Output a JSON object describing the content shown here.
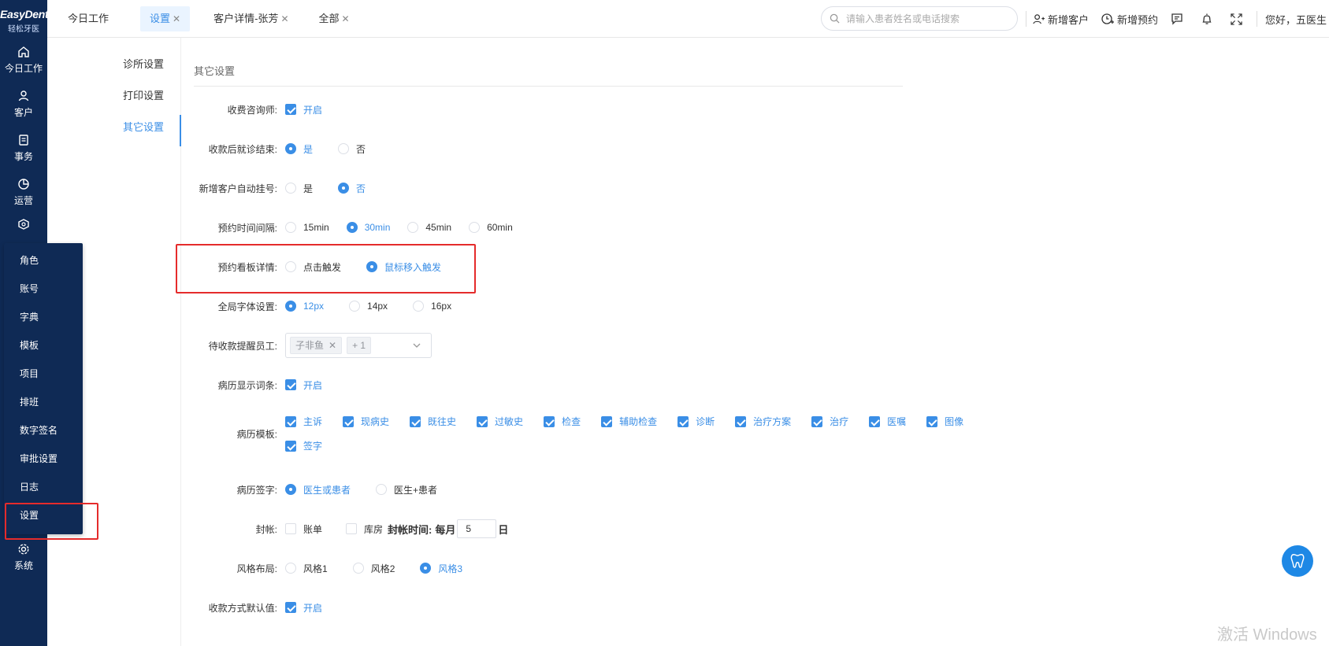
{
  "app": {
    "brand": "EasyDent",
    "brand_sub": "轻松牙医"
  },
  "sidenav": {
    "items": [
      {
        "label": "今日工作",
        "icon": "home-icon"
      },
      {
        "label": "客户",
        "icon": "user-icon"
      },
      {
        "label": "事务",
        "icon": "document-icon"
      },
      {
        "label": "运营",
        "icon": "pie-chart-icon"
      }
    ],
    "system_label": "系统"
  },
  "flyout": {
    "items": [
      "角色",
      "账号",
      "字典",
      "模板",
      "项目",
      "排班",
      "数字签名",
      "审批设置",
      "日志",
      "设置"
    ]
  },
  "tabs": [
    {
      "label": "今日工作",
      "closable": false
    },
    {
      "label": "设置",
      "closable": true,
      "active": true
    },
    {
      "label": "客户详情-张芳",
      "closable": true
    },
    {
      "label": "全部",
      "closable": true
    }
  ],
  "search": {
    "placeholder": "请输入患者姓名或电话搜索"
  },
  "actions": {
    "new_customer": "新增客户",
    "new_appointment": "新增预约",
    "greeting": "您好，五医生"
  },
  "settings_menu": [
    "诊所设置",
    "打印设置",
    "其它设置"
  ],
  "section_title": "其它设置",
  "form": {
    "fee_consultant": {
      "label": "收费咨询师:",
      "opt": "开启"
    },
    "end_after_pay": {
      "label": "收款后就诊结束:",
      "opts": [
        "是",
        "否"
      ]
    },
    "auto_register": {
      "label": "新增客户自动挂号:",
      "opts": [
        "是",
        "否"
      ]
    },
    "appt_interval": {
      "label": "预约时间间隔:",
      "opts": [
        "15min",
        "30min",
        "45min",
        "60min"
      ]
    },
    "board_detail": {
      "label": "预约看板详情:",
      "opts": [
        "点击触发",
        "鼠标移入触发"
      ]
    },
    "font_size": {
      "label": "全局字体设置:",
      "opts": [
        "12px",
        "14px",
        "16px"
      ]
    },
    "payment_remind": {
      "label": "待收款提醒员工:",
      "tag": "子非鱼",
      "more": "+ 1"
    },
    "record_terms": {
      "label": "病历显示词条:",
      "opt": "开启"
    },
    "record_template": {
      "label": "病历模板:",
      "opts": [
        "主诉",
        "现病史",
        "既往史",
        "过敏史",
        "检查",
        "辅助检查",
        "诊断",
        "治疗方案",
        "治疗",
        "医嘱",
        "图像",
        "签字"
      ]
    },
    "record_sign": {
      "label": "病历签字:",
      "opts": [
        "医生或患者",
        "医生+患者"
      ]
    },
    "closing": {
      "label": "封帐:",
      "opts": [
        "账单",
        "库房"
      ],
      "time_label": "封帐时间:",
      "prefix": "每月",
      "value": "5",
      "suffix": "日"
    },
    "layout_style": {
      "label": "风格布局:",
      "opts": [
        "风格1",
        "风格2",
        "风格3"
      ]
    },
    "pay_default": {
      "label": "收款方式默认值:",
      "opt": "开启"
    }
  },
  "watermark": "激活 Windows"
}
